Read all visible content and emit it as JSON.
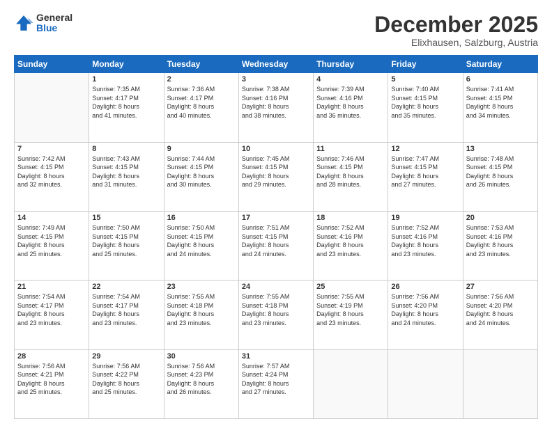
{
  "logo": {
    "general": "General",
    "blue": "Blue"
  },
  "header": {
    "month": "December 2025",
    "location": "Elixhausen, Salzburg, Austria"
  },
  "weekdays": [
    "Sunday",
    "Monday",
    "Tuesday",
    "Wednesday",
    "Thursday",
    "Friday",
    "Saturday"
  ],
  "weeks": [
    [
      {
        "day": "",
        "rise": "",
        "set": "",
        "daylight": "",
        "empty": true
      },
      {
        "day": "1",
        "rise": "7:35 AM",
        "set": "4:17 PM",
        "daylight": "8 hours and 41 minutes."
      },
      {
        "day": "2",
        "rise": "7:36 AM",
        "set": "4:17 PM",
        "daylight": "8 hours and 40 minutes."
      },
      {
        "day": "3",
        "rise": "7:38 AM",
        "set": "4:16 PM",
        "daylight": "8 hours and 38 minutes."
      },
      {
        "day": "4",
        "rise": "7:39 AM",
        "set": "4:16 PM",
        "daylight": "8 hours and 36 minutes."
      },
      {
        "day": "5",
        "rise": "7:40 AM",
        "set": "4:15 PM",
        "daylight": "8 hours and 35 minutes."
      },
      {
        "day": "6",
        "rise": "7:41 AM",
        "set": "4:15 PM",
        "daylight": "8 hours and 34 minutes."
      }
    ],
    [
      {
        "day": "7",
        "rise": "7:42 AM",
        "set": "4:15 PM",
        "daylight": "8 hours and 32 minutes."
      },
      {
        "day": "8",
        "rise": "7:43 AM",
        "set": "4:15 PM",
        "daylight": "8 hours and 31 minutes."
      },
      {
        "day": "9",
        "rise": "7:44 AM",
        "set": "4:15 PM",
        "daylight": "8 hours and 30 minutes."
      },
      {
        "day": "10",
        "rise": "7:45 AM",
        "set": "4:15 PM",
        "daylight": "8 hours and 29 minutes."
      },
      {
        "day": "11",
        "rise": "7:46 AM",
        "set": "4:15 PM",
        "daylight": "8 hours and 28 minutes."
      },
      {
        "day": "12",
        "rise": "7:47 AM",
        "set": "4:15 PM",
        "daylight": "8 hours and 27 minutes."
      },
      {
        "day": "13",
        "rise": "7:48 AM",
        "set": "4:15 PM",
        "daylight": "8 hours and 26 minutes."
      }
    ],
    [
      {
        "day": "14",
        "rise": "7:49 AM",
        "set": "4:15 PM",
        "daylight": "8 hours and 25 minutes."
      },
      {
        "day": "15",
        "rise": "7:50 AM",
        "set": "4:15 PM",
        "daylight": "8 hours and 25 minutes."
      },
      {
        "day": "16",
        "rise": "7:50 AM",
        "set": "4:15 PM",
        "daylight": "8 hours and 24 minutes."
      },
      {
        "day": "17",
        "rise": "7:51 AM",
        "set": "4:15 PM",
        "daylight": "8 hours and 24 minutes."
      },
      {
        "day": "18",
        "rise": "7:52 AM",
        "set": "4:16 PM",
        "daylight": "8 hours and 23 minutes."
      },
      {
        "day": "19",
        "rise": "7:52 AM",
        "set": "4:16 PM",
        "daylight": "8 hours and 23 minutes."
      },
      {
        "day": "20",
        "rise": "7:53 AM",
        "set": "4:16 PM",
        "daylight": "8 hours and 23 minutes."
      }
    ],
    [
      {
        "day": "21",
        "rise": "7:54 AM",
        "set": "4:17 PM",
        "daylight": "8 hours and 23 minutes."
      },
      {
        "day": "22",
        "rise": "7:54 AM",
        "set": "4:17 PM",
        "daylight": "8 hours and 23 minutes."
      },
      {
        "day": "23",
        "rise": "7:55 AM",
        "set": "4:18 PM",
        "daylight": "8 hours and 23 minutes."
      },
      {
        "day": "24",
        "rise": "7:55 AM",
        "set": "4:18 PM",
        "daylight": "8 hours and 23 minutes."
      },
      {
        "day": "25",
        "rise": "7:55 AM",
        "set": "4:19 PM",
        "daylight": "8 hours and 23 minutes."
      },
      {
        "day": "26",
        "rise": "7:56 AM",
        "set": "4:20 PM",
        "daylight": "8 hours and 24 minutes."
      },
      {
        "day": "27",
        "rise": "7:56 AM",
        "set": "4:20 PM",
        "daylight": "8 hours and 24 minutes."
      }
    ],
    [
      {
        "day": "28",
        "rise": "7:56 AM",
        "set": "4:21 PM",
        "daylight": "8 hours and 25 minutes."
      },
      {
        "day": "29",
        "rise": "7:56 AM",
        "set": "4:22 PM",
        "daylight": "8 hours and 25 minutes."
      },
      {
        "day": "30",
        "rise": "7:56 AM",
        "set": "4:23 PM",
        "daylight": "8 hours and 26 minutes."
      },
      {
        "day": "31",
        "rise": "7:57 AM",
        "set": "4:24 PM",
        "daylight": "8 hours and 27 minutes."
      },
      {
        "day": "",
        "rise": "",
        "set": "",
        "daylight": "",
        "empty": true
      },
      {
        "day": "",
        "rise": "",
        "set": "",
        "daylight": "",
        "empty": true
      },
      {
        "day": "",
        "rise": "",
        "set": "",
        "daylight": "",
        "empty": true
      }
    ]
  ]
}
